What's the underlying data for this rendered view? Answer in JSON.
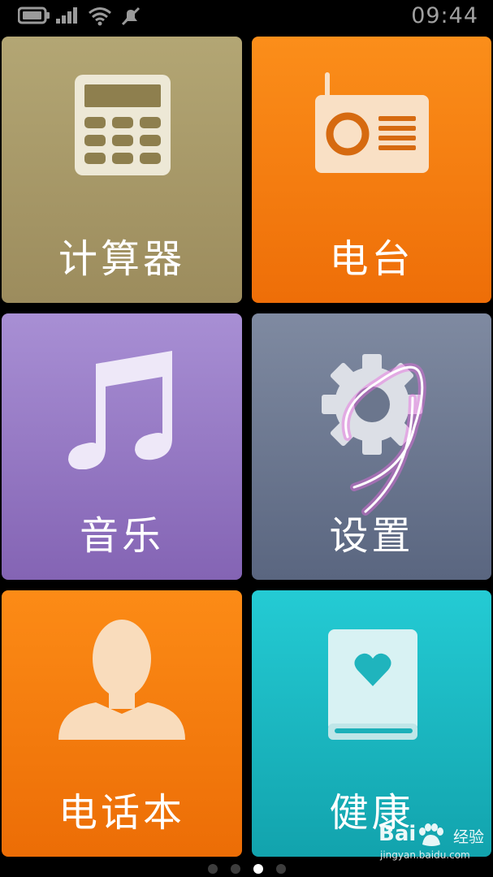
{
  "status_bar": {
    "time": "09:44",
    "icons": [
      "battery-icon",
      "signal-icon",
      "wifi-icon",
      "mute-icon"
    ]
  },
  "tiles": [
    {
      "label": "计算器",
      "icon": "calculator-icon",
      "color": "#a8996a"
    },
    {
      "label": "电台",
      "icon": "radio-icon",
      "color": "#f57d10"
    },
    {
      "label": "音乐",
      "icon": "music-note-icon",
      "color": "#9678c4"
    },
    {
      "label": "设置",
      "icon": "gear-icon",
      "color": "#6d7890"
    },
    {
      "label": "电话本",
      "icon": "contact-person-icon",
      "color": "#f57c0e"
    },
    {
      "label": "健康",
      "icon": "health-book-icon",
      "color": "#1bb7c0"
    }
  ],
  "pager": {
    "pages": 4,
    "active": 3
  },
  "watermark": {
    "brand": "Bai",
    "brand_cn": "经验",
    "url": "jingyan.baidu.com"
  }
}
